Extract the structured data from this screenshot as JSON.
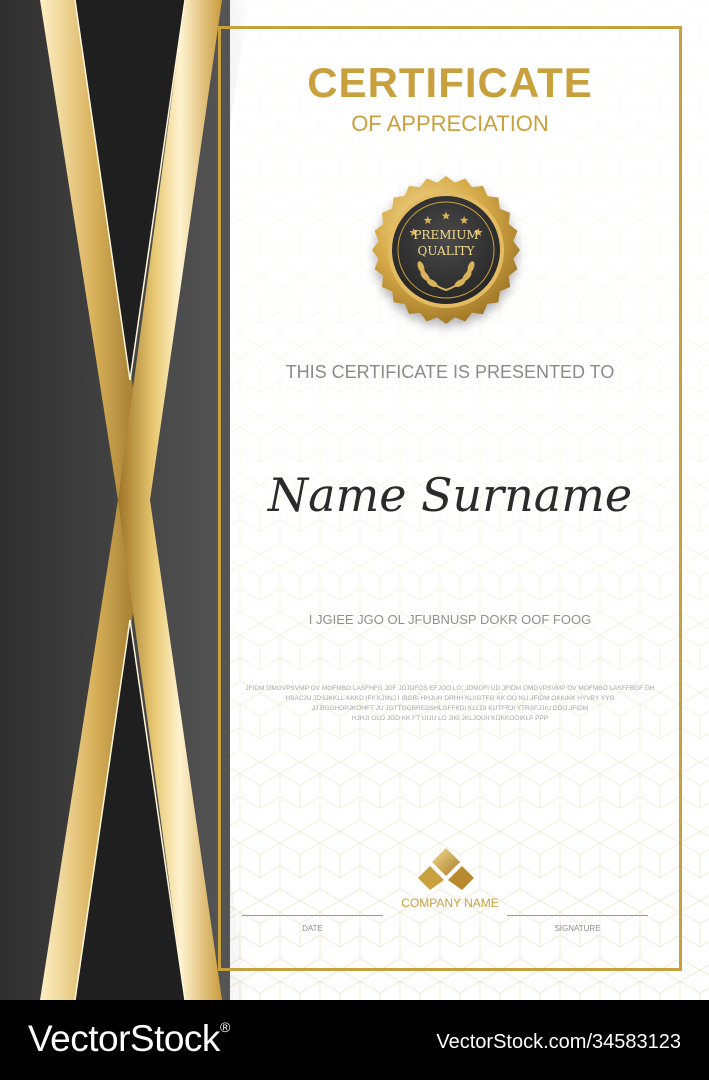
{
  "certificate": {
    "title": "CERTIFICATE",
    "subtitle": "OF APPRECIATION",
    "badge": {
      "line1": "PREMIUM",
      "line2": "QUALITY",
      "star_count": 5,
      "icon": "laurel-wreath-icon"
    },
    "presented_to": "THIS CERTIFICATE IS PRESENTED TO",
    "recipient_name": "Name Surname",
    "caps_line": "I JGIEE JGO OL JFUBNUSP DOKR OOF FOOG",
    "body_lines": [
      "JFIDM OMGVPSVMP OV MOFMBO LASFHFG JDF JDJDFOS EFJOO LO, JDMDFI UD JFIDM OMGVPSVMP OV MOFMBO LASFFBGF GH",
      "HSACJU JDSJKKLL KKKD IFII  KJIINJ I IBGBI HHJUH DRHH KLIIGTFG KK OO KLI JFIDM OKKIKK HYVBY YYG",
      "JJ BGGHOPJKOHFT JU JGTTGGBREDSHLGFFKDI KLLOI KUTFRJI YTRSFJJIU DDIJ JFIDM",
      "HJHJI OLO JGD KK FT UIJU LO JIKI JKLJOUII KIJKKOOIKLP PPP"
    ],
    "company_name": "COMPANY NAME",
    "date_label": "DATE",
    "signature_label": "SIGNATURE"
  },
  "footer": {
    "brand": "VectorStock",
    "registered_mark": "®",
    "stock_id": "VectorStock.com/34583123"
  },
  "colors": {
    "gold": "#c9a03e",
    "dark_gray": "#3a3a3a",
    "black_band": "#1f1f1f",
    "footer": "#000000"
  }
}
